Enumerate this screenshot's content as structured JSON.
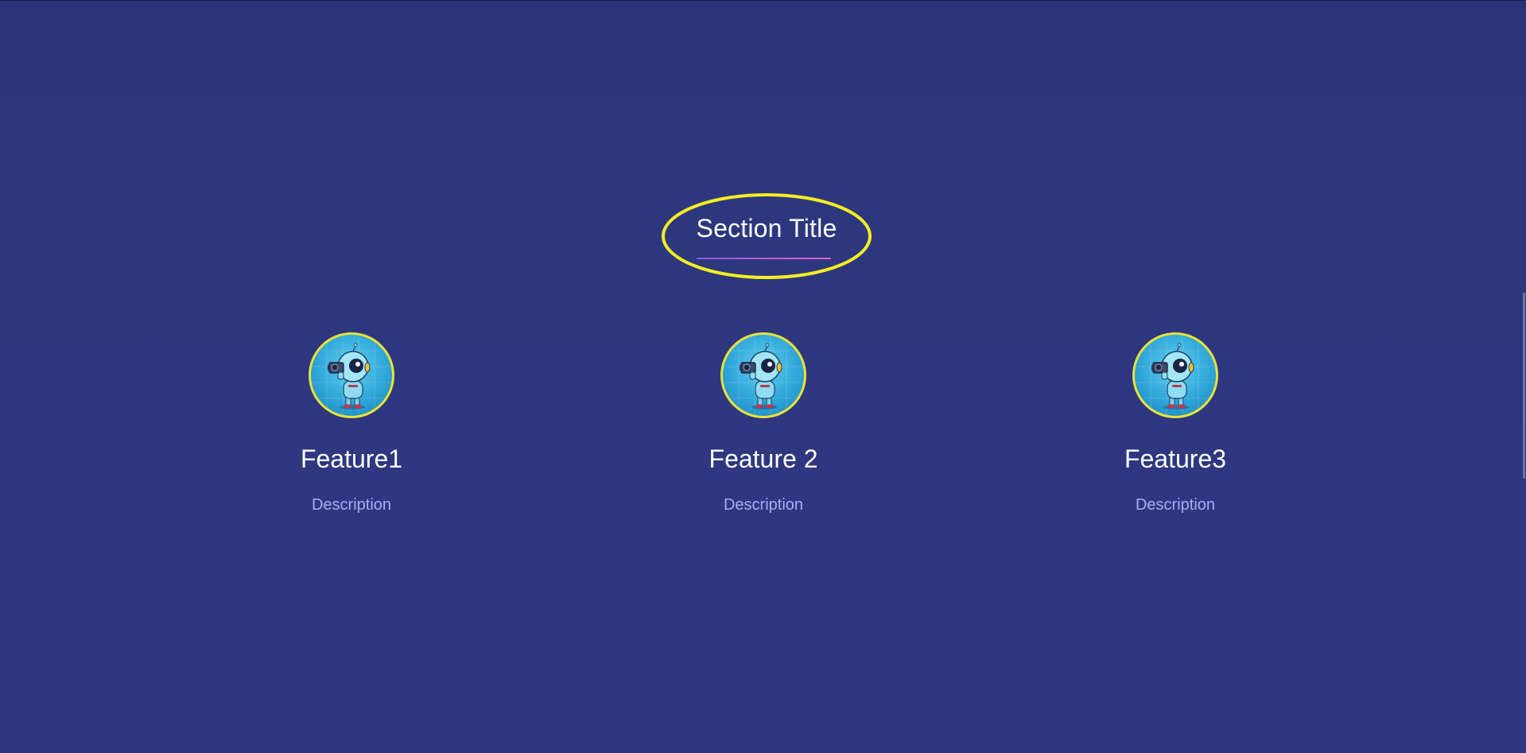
{
  "section": {
    "title": "Section Title"
  },
  "features": [
    {
      "title": "Feature1",
      "description": "Description",
      "icon": "robot-camera-avatar"
    },
    {
      "title": "Feature 2",
      "description": "Description",
      "icon": "robot-camera-avatar"
    },
    {
      "title": "Feature3",
      "description": "Description",
      "icon": "robot-camera-avatar"
    }
  ],
  "colors": {
    "background": "#2d377e",
    "highlight_ellipse": "#f4ee21",
    "title_underline": "#d65bd6",
    "avatar_border": "#e8e23a",
    "description_text": "#a5b0f5"
  }
}
